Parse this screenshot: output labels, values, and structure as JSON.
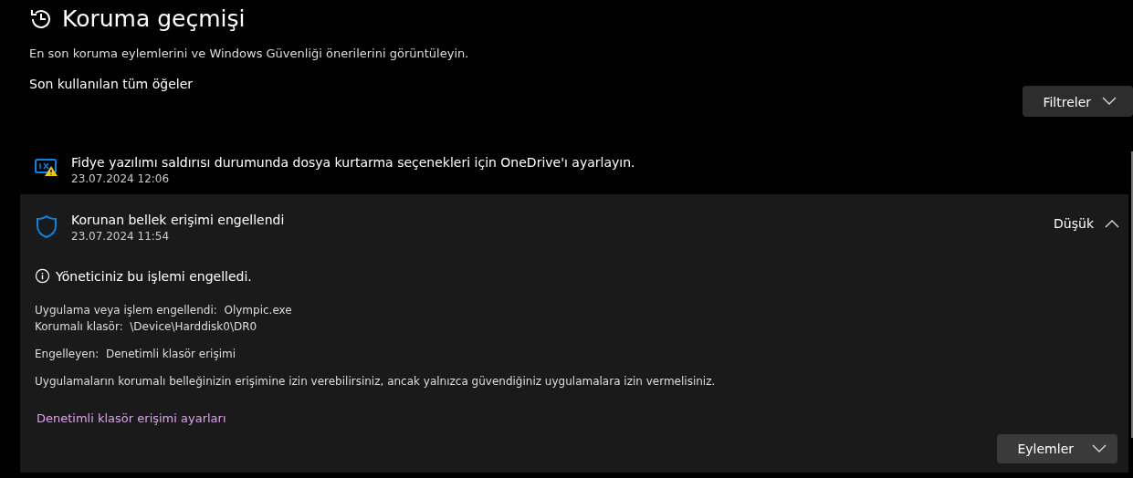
{
  "page": {
    "title": "Koruma geçmişi",
    "subtitle": "En son koruma eylemlerini ve Windows Güvenliği önerilerini görüntüleyin.",
    "filter_label": "Son kullanılan tüm öğeler",
    "filter_button": "Filtreler"
  },
  "items": [
    {
      "kind": "onedrive",
      "title": "Fidye yazılımı saldırısı durumunda dosya kurtarma seçenekleri için OneDrive'ı ayarlayın.",
      "date": "23.07.2024 12:06",
      "expanded": false
    },
    {
      "kind": "shield",
      "title": "Korunan bellek erişimi engellendi",
      "date": "23.07.2024 11:54",
      "expanded": true,
      "severity": "Düşük",
      "details": {
        "notice": "Yöneticiniz bu işlemi engelledi.",
        "fields": [
          {
            "label": "Uygulama veya işlem engellendi:",
            "value": "Olympic.exe"
          },
          {
            "label": "Korumalı klasör:",
            "value": "\\Device\\Harddisk0\\DR0"
          }
        ],
        "blocked_by": {
          "label": "Engelleyen:",
          "value": "Denetimli klasör erişimi"
        },
        "description": "Uygulamaların korumalı belleğinizin erişimine izin verebilirsiniz, ancak yalnızca güvendiğiniz uygulamalara izin vermelisiniz.",
        "link": "Denetimli klasör erişimi ayarları",
        "actions_button": "Eylemler"
      }
    }
  ]
}
